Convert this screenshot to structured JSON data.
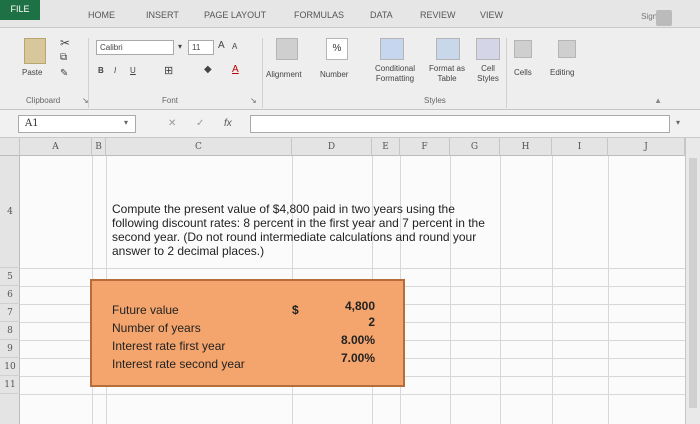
{
  "tabs": [
    "FILE",
    "HOME",
    "INSERT",
    "PAGE LAYOUT",
    "FORMULAS",
    "DATA",
    "REVIEW",
    "VIEW"
  ],
  "sign_in": "Sign In",
  "ribbon": {
    "paste": "Paste",
    "clipboard": "Clipboard",
    "font_name": "Calibri",
    "font_size": "11",
    "font_group": "Font",
    "bold": "B",
    "italic": "I",
    "underline": "U",
    "grow_font": "A",
    "shrink_font": "A",
    "font_color": "A",
    "alignment": "Alignment",
    "number": "Number",
    "percent": "%",
    "conditional_formatting": "Conditional Formatting",
    "format_as_table": "Format as Table",
    "cell_styles": "Cell Styles",
    "styles": "Styles",
    "cells": "Cells",
    "editing": "Editing"
  },
  "formula_bar": {
    "name_box": "A1",
    "fx": "fx",
    "formula": ""
  },
  "columns": [
    "A",
    "B",
    "C",
    "D",
    "E",
    "F",
    "G",
    "H",
    "I",
    "J"
  ],
  "rows": [
    "4",
    "5",
    "6",
    "7",
    "8",
    "9",
    "10",
    "11"
  ],
  "question_text": "Compute the present value of $4,800 paid in two years using the following discount rates: 8 percent in the first year and 7 percent in the second year. (Do not round intermediate calculations and round your answer to 2 decimal places.)",
  "data_table": {
    "rows": [
      {
        "label": "Future value",
        "value": "4,800"
      },
      {
        "label": "Number of years",
        "value": "2"
      },
      {
        "label": "Interest rate first year",
        "value": "8.00%"
      },
      {
        "label": "Interest rate second year",
        "value": "7.00%"
      }
    ],
    "currency": "$"
  }
}
